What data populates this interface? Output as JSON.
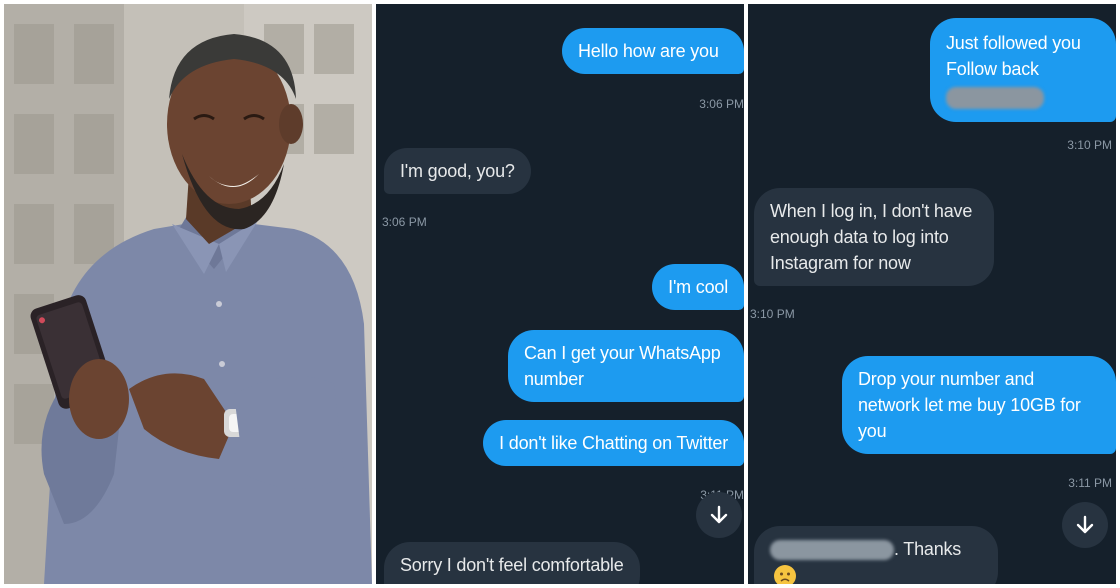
{
  "panel_conversation_1": {
    "messages": [
      {
        "text": "Hello how are you",
        "direction": "outgoing"
      },
      {
        "text": "I'm good, you?",
        "direction": "incoming"
      },
      {
        "text": "I'm cool",
        "direction": "outgoing"
      },
      {
        "text": "Can I get your WhatsApp number",
        "direction": "outgoing"
      },
      {
        "text": "I don't like Chatting on Twitter",
        "direction": "outgoing"
      },
      {
        "text": "Sorry I don't feel comfortable",
        "direction": "incoming"
      }
    ],
    "timestamps": [
      "3:06 PM",
      "3:06 PM",
      "3:11 PM"
    ]
  },
  "panel_conversation_2": {
    "messages": [
      {
        "text": "Just followed you Follow back",
        "direction": "outgoing"
      },
      {
        "text": "When I log in, I don't have enough data to log into Instagram for now",
        "direction": "incoming"
      },
      {
        "text": "Drop your number and network let me buy 10GB for you",
        "direction": "outgoing"
      },
      {
        "text": ". Thanks",
        "direction": "incoming"
      }
    ],
    "timestamps": [
      "3:10 PM",
      "3:10 PM",
      "3:11 PM"
    ]
  },
  "icons": {
    "scroll_down": "arrow-down-icon",
    "emoji": "worried-face-emoji"
  },
  "colors": {
    "background": "#15202b",
    "outgoing_bubble": "#1d9bf0",
    "incoming_bubble": "#273340",
    "timestamp": "#8b98a5"
  }
}
